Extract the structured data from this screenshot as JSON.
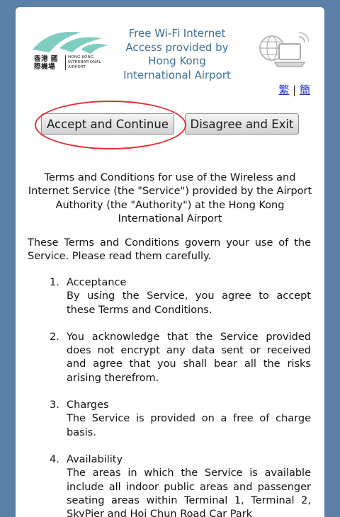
{
  "header": {
    "logo": {
      "chinese": "香港 國際機場",
      "english": "HONG KONG INTERNATIONAL AIRPORT",
      "color": "#7ecdc0"
    },
    "title": "Free Wi-Fi Internet Access provided by Hong Kong International Airport",
    "icon": "laptop-wifi-icon"
  },
  "language": {
    "traditional": "繁",
    "separator": "|",
    "simplified": "簡"
  },
  "buttons": {
    "accept": "Accept and Continue",
    "disagree": "Disagree and Exit"
  },
  "terms": {
    "title": "Terms and Conditions for use of the Wireless and Internet Service (the \"Service\") provided by the Airport Authority (the \"Authority\") at the Hong Kong International Airport",
    "intro": "These Terms and Conditions govern your use of the Service. Please read them carefully.",
    "clauses": [
      {
        "number": "1.",
        "heading": "Acceptance",
        "body": "By using the Service, you agree to accept these Terms and Conditions."
      },
      {
        "number": "2.",
        "heading": "",
        "body": "You acknowledge that the Service provided does not encrypt any data sent or received and agree that you shall bear all the risks arising therefrom."
      },
      {
        "number": "3.",
        "heading": "Charges",
        "body": "The Service is provided on a free of charge basis."
      },
      {
        "number": "4.",
        "heading": "Availability",
        "body": "The areas in which the Service is available include all indoor public areas and passenger seating areas within Terminal 1, Terminal 2, SkyPier and Hoi Chun Road Car Park"
      }
    ]
  },
  "colors": {
    "background": "#5b7fa6",
    "header_text": "#3d6f96",
    "link": "#2233cc",
    "highlight": "#e23030"
  }
}
